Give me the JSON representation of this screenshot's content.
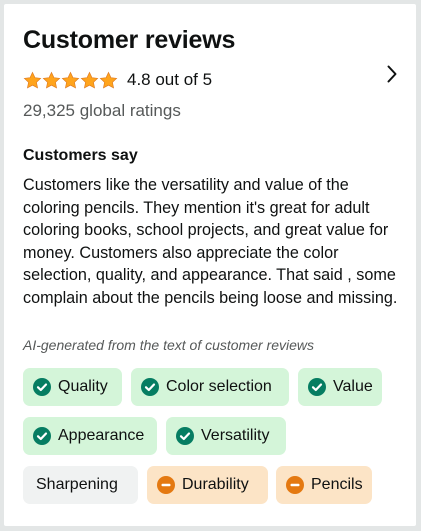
{
  "reviews": {
    "title": "Customer reviews",
    "rating_value": 4.8,
    "rating_text": "4.8 out of 5",
    "global_ratings": "29,325 global ratings",
    "star_color": "#ffa41c",
    "chevron_icon": "chevron-right-icon"
  },
  "customers_say": {
    "title": "Customers say",
    "summary": "Customers like the versatility and value of the coloring pencils. They mention it's great for adult coloring books, school projects, and great value for money. Customers also appreciate the color selection, quality, and appearance. That said , some complain about the pencils being loose and missing.",
    "ai_note": "AI-generated from the text of customer reviews"
  },
  "aspects": [
    {
      "label": "Quality",
      "sentiment": "positive",
      "icon": "check-circle-icon"
    },
    {
      "label": "Color selection",
      "sentiment": "positive",
      "icon": "check-circle-icon"
    },
    {
      "label": "Value",
      "sentiment": "positive",
      "icon": "check-circle-icon"
    },
    {
      "label": "Appearance",
      "sentiment": "positive",
      "icon": "check-circle-icon"
    },
    {
      "label": "Versatility",
      "sentiment": "positive",
      "icon": "check-circle-icon"
    },
    {
      "label": "Sharpening",
      "sentiment": "neutral",
      "icon": ""
    },
    {
      "label": "Durability",
      "sentiment": "negative",
      "icon": "minus-circle-icon"
    },
    {
      "label": "Pencils",
      "sentiment": "negative",
      "icon": "minus-circle-icon"
    }
  ],
  "colors": {
    "positive_chip": "#d4f5d9",
    "positive_icon": "#067d62",
    "neutral_chip": "#f0f2f2",
    "negative_chip": "#fce4c6",
    "negative_icon": "#e47911"
  }
}
